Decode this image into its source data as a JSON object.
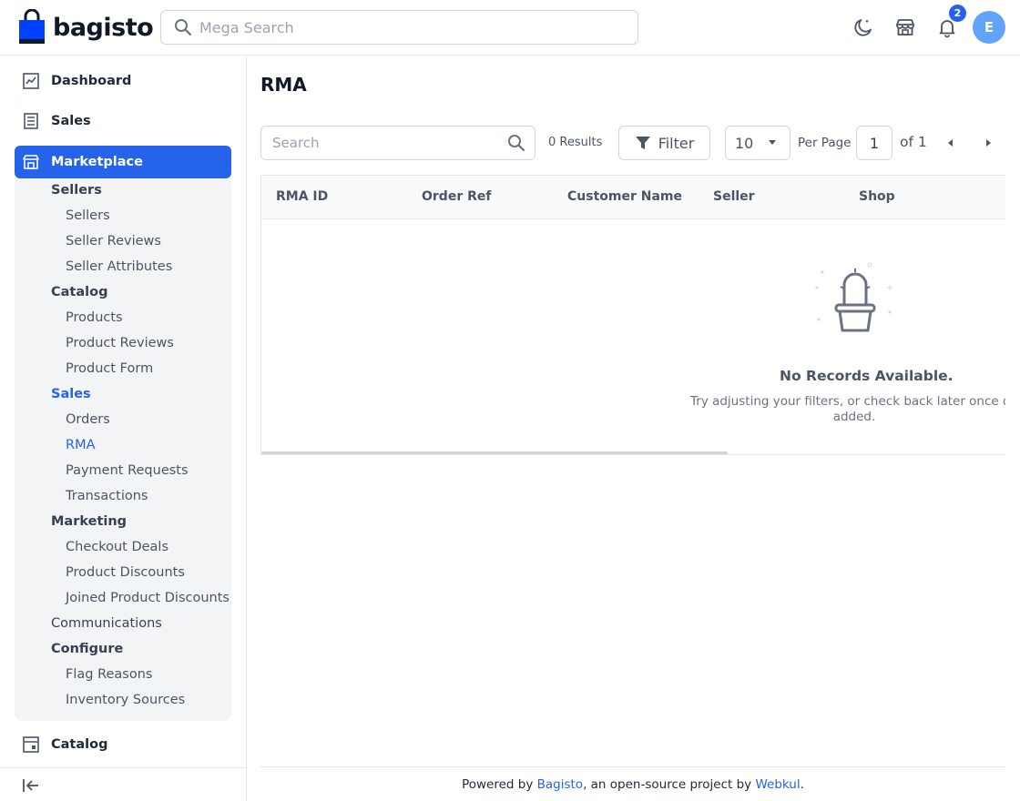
{
  "header": {
    "logo_text": "bagisto",
    "search_placeholder": "Mega Search",
    "notification_count": "2",
    "avatar_initial": "E",
    "accent_color": "#2563eb"
  },
  "sidebar": {
    "top": [
      {
        "label": "Dashboard",
        "icon": "dashboard-icon"
      },
      {
        "label": "Sales",
        "icon": "sales-icon"
      },
      {
        "label": "Marketplace",
        "icon": "store-icon"
      }
    ],
    "marketplace_sections": {
      "sellers": {
        "label": "Sellers",
        "items": [
          "Sellers",
          "Seller Reviews",
          "Seller Attributes"
        ]
      },
      "catalog": {
        "label": "Catalog",
        "items": [
          "Products",
          "Product Reviews",
          "Product Form"
        ]
      },
      "sales": {
        "label": "Sales",
        "items": [
          "Orders",
          "RMA",
          "Payment Requests",
          "Transactions"
        ]
      },
      "marketing": {
        "label": "Marketing",
        "items": [
          "Checkout Deals",
          "Product Discounts",
          "Joined Product Discounts"
        ]
      },
      "communications": {
        "label": "Communications"
      },
      "configure": {
        "label": "Configure",
        "items": [
          "Flag Reasons",
          "Inventory Sources"
        ]
      }
    },
    "bottom_item": {
      "label": "Catalog",
      "icon": "catalog-icon"
    }
  },
  "main": {
    "title": "RMA",
    "search_placeholder": "Search",
    "results_text": "0 Results",
    "filter_label": "Filter",
    "per_page_value": "10",
    "per_page_label": "Per Page",
    "current_page": "1",
    "of_pages": "of 1",
    "columns": [
      "RMA ID",
      "Order Ref",
      "Customer Name",
      "Seller",
      "Shop"
    ],
    "empty_title": "No Records Available.",
    "empty_subtitle": "Try adjusting your filters, or check back later once data",
    "empty_subtitle_2": "added."
  },
  "footer": {
    "prefix": "Powered by ",
    "bagisto": "Bagisto",
    "middle": ", an open-source project by ",
    "webkul": "Webkul",
    "suffix": "."
  }
}
